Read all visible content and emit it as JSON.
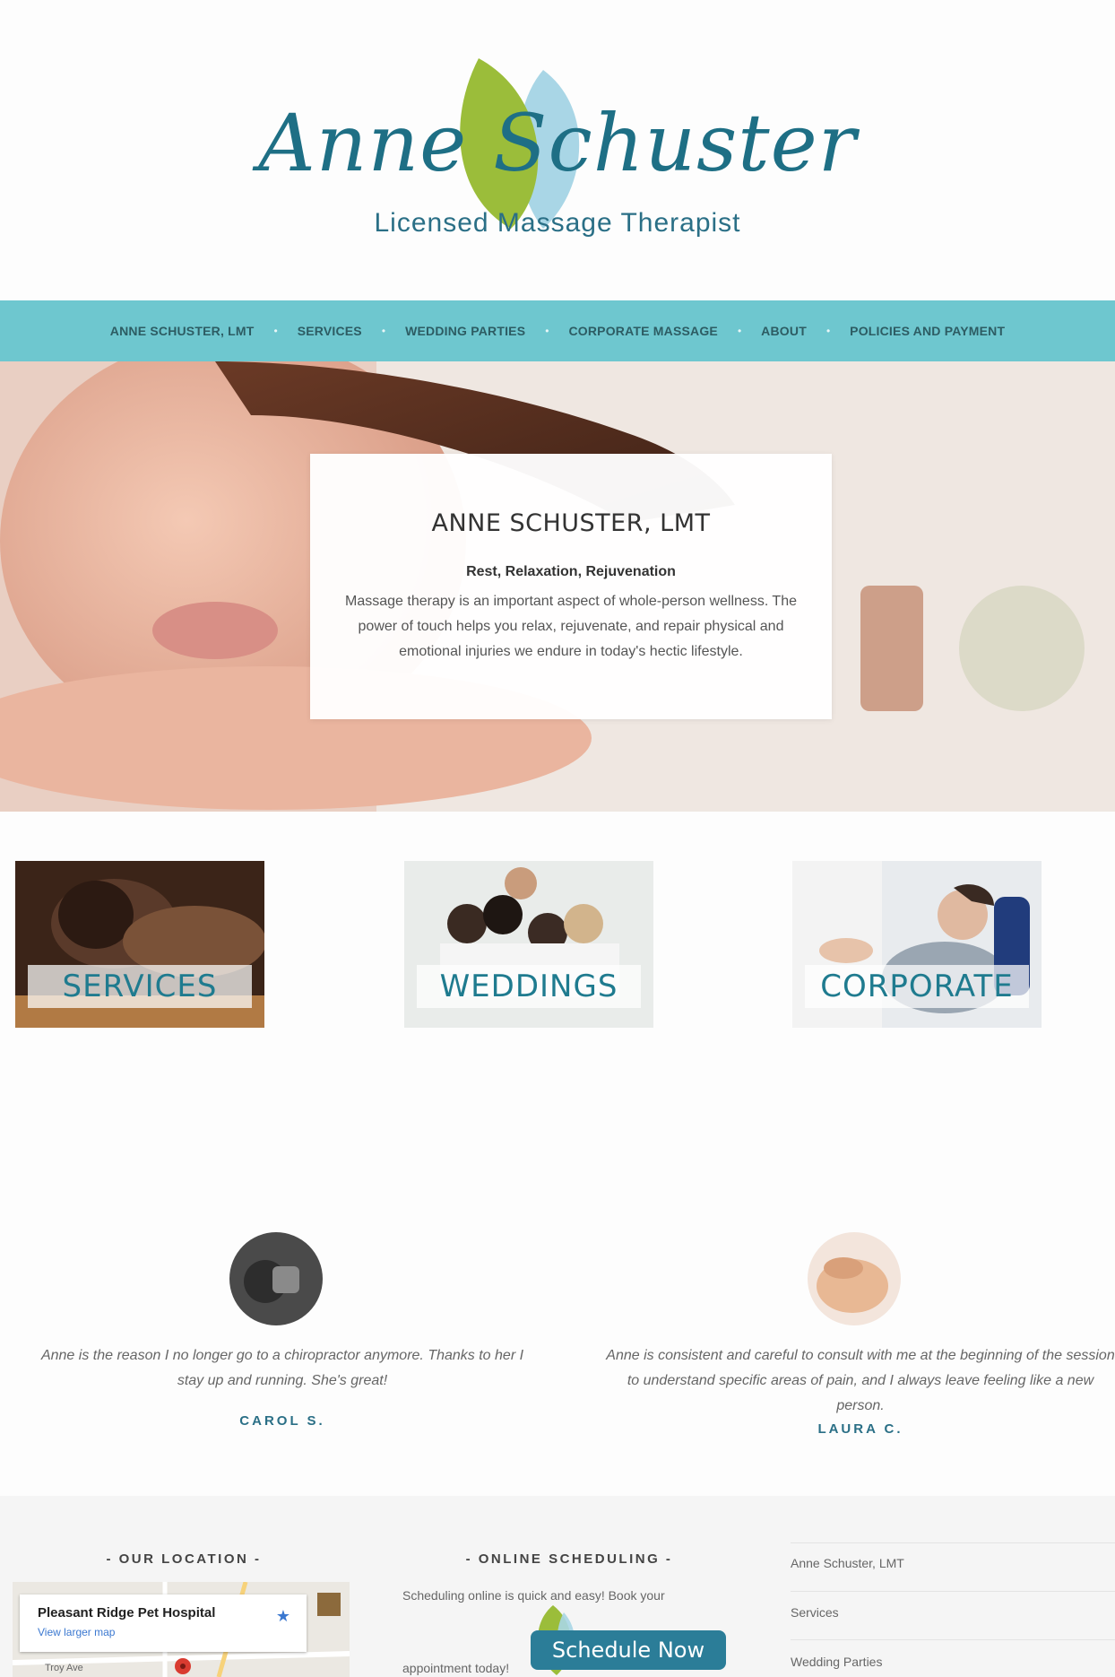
{
  "logo": {
    "script_text": "Anne Schuster",
    "subtitle": "Licensed Massage Therapist"
  },
  "nav": {
    "items": [
      "ANNE SCHUSTER, LMT",
      "SERVICES",
      "WEDDING PARTIES",
      "CORPORATE MASSAGE",
      "ABOUT",
      "POLICIES AND PAYMENT"
    ]
  },
  "hero": {
    "title": "ANNE SCHUSTER, LMT",
    "subtitle": "Rest, Relaxation, Rejuvenation",
    "text": "Massage therapy is an important aspect of whole-person wellness. The power of touch helps you relax, rejuvenate, and repair physical and emotional injuries we endure in today's hectic lifestyle."
  },
  "tiles": [
    {
      "label": "SERVICES"
    },
    {
      "label": "WEDDINGS"
    },
    {
      "label": "CORPORATE"
    }
  ],
  "testimonials": [
    {
      "quote": "Anne is the reason I no longer go to a chiropractor anymore. Thanks to her I stay up and running. She's great!",
      "name": "CAROL S."
    },
    {
      "quote": "Anne is consistent and careful to consult with me at the beginning of the session to understand specific areas of pain, and I always leave feeling like a new person.",
      "name": "LAURA C."
    }
  ],
  "footer": {
    "location_heading": "- OUR LOCATION -",
    "map_place": "Pleasant Ridge Pet Hospital",
    "map_link": "View larger map",
    "map_street": "Troy Ave",
    "scheduling_heading": "- ONLINE SCHEDULING -",
    "scheduling_text_1": "Scheduling online is quick and easy! Book your",
    "scheduling_text_2": "appointment today!",
    "schedule_button": "Schedule Now",
    "links": [
      "Anne Schuster, LMT",
      "Services",
      "Wedding Parties"
    ]
  },
  "colors": {
    "nav_bg": "#6ec7cf",
    "brand_teal": "#1e6f85",
    "leaf_green": "#9bbd3a",
    "leaf_blue": "#a9d6e6"
  }
}
